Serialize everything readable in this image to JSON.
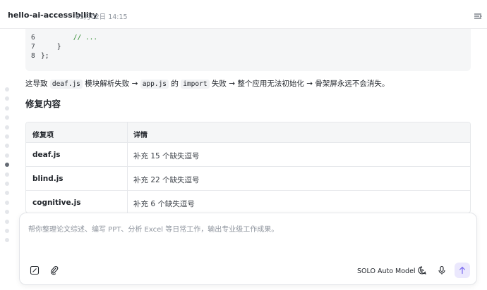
{
  "header": {
    "title": "hello-ai-accessibility",
    "date": "05月02日 14:15"
  },
  "code": {
    "lines": [
      {
        "num": "6",
        "text": "        // ...",
        "is_comment": true
      },
      {
        "num": "7",
        "text": "    }",
        "is_comment": false
      },
      {
        "num": "8",
        "text": "};",
        "is_comment": false
      }
    ]
  },
  "paragraph": {
    "part1": "这导致 ",
    "code1": "deaf.js",
    "part2": " 模块解析失败 → ",
    "code2": "app.js",
    "part3": " 的 ",
    "code3": "import",
    "part4": " 失败 → 整个应用无法初始化 → 骨架屏永远不会消失。"
  },
  "section_title": "修复内容",
  "table": {
    "headers": [
      "修复项",
      "详情"
    ],
    "rows": [
      {
        "item": "deaf.js",
        "detail": "补充 15 个缺失逗号"
      },
      {
        "item": "blind.js",
        "detail": "补充 22 个缺失逗号"
      },
      {
        "item": "cognitive.js",
        "detail": "补充 6 个缺失逗号"
      }
    ]
  },
  "composer": {
    "placeholder": "帮你整理论文综述、编写 PPT、分析 Excel 等日常工作，输出专业级工作成果。",
    "model_label": "SOLO Auto Model"
  },
  "timeline": {
    "active_index": 8,
    "count": 17
  },
  "colors": {
    "accent_send_bg": "#ebe8fd",
    "accent_send_icon": "#7c6cf0",
    "comment_green": "#2e8b2e"
  }
}
